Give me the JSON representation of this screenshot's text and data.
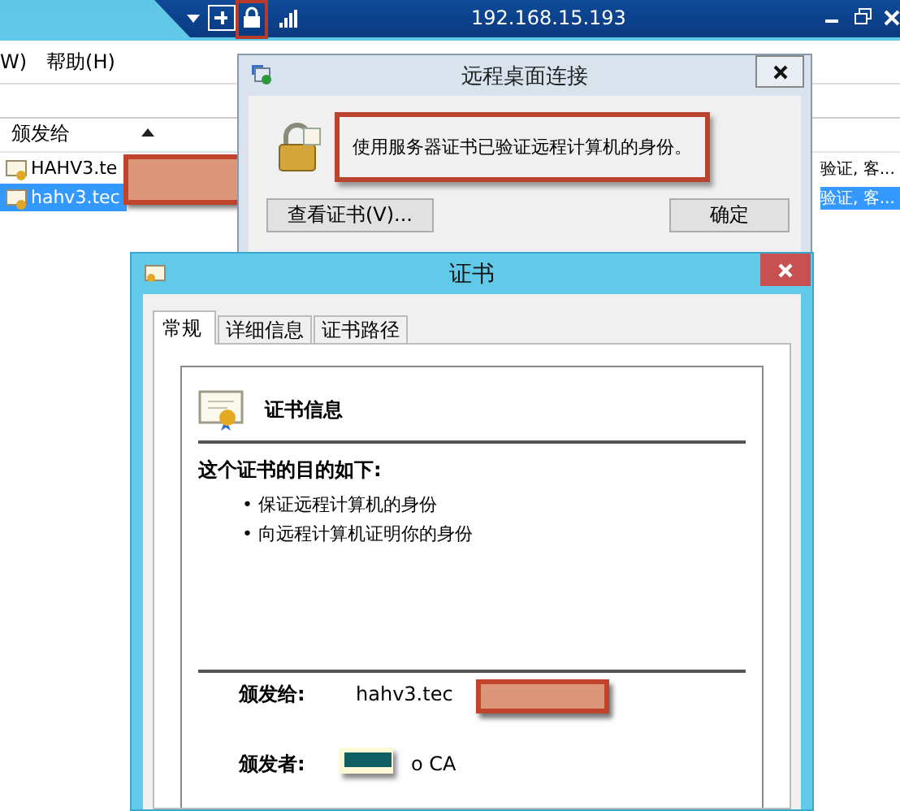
{
  "connection_bar": {
    "title": "192.168.15.193"
  },
  "background_window": {
    "menu": [
      "W)",
      "帮助(H)"
    ],
    "column": "颁发给",
    "rows": [
      {
        "name": "HAHV3.te",
        "column_2": "验证, 客...",
        "selected": false
      },
      {
        "name": "hahv3.tec",
        "column_2": "验证, 客...",
        "selected": true
      }
    ]
  },
  "rdp_dialog": {
    "title": "远程桌面连接",
    "message": "使用服务器证书已验证远程计算机的身份。",
    "buttons": [
      "查看证书(V)...",
      "确定"
    ]
  },
  "certificate_dialog": {
    "title": "证书",
    "tabs": [
      {
        "label": "常规",
        "selected": true
      },
      {
        "label": "详细信息",
        "selected": false
      },
      {
        "label": "证书路径",
        "selected": false
      }
    ],
    "heading": "证书信息",
    "purpose_title": "这个证书的目的如下:",
    "purposes": [
      "• 保证远程计算机的身份",
      "• 向远程计算机证明你的身份"
    ],
    "fields": [
      {
        "label": "颁发给:",
        "value": "hahv3.tec"
      },
      {
        "label": "颁发者:",
        "value": "o CA"
      }
    ]
  }
}
